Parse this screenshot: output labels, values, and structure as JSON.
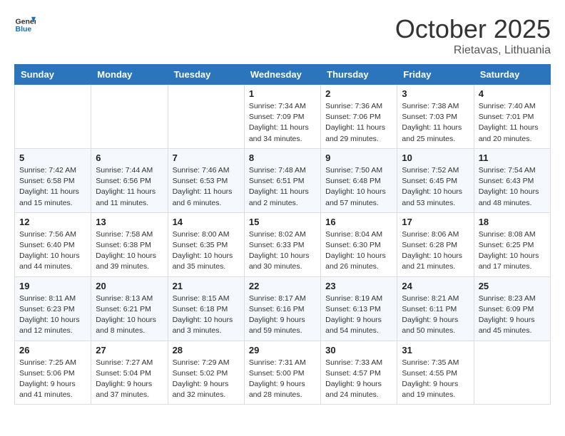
{
  "header": {
    "logo_general": "General",
    "logo_blue": "Blue",
    "month": "October 2025",
    "location": "Rietavas, Lithuania"
  },
  "days_of_week": [
    "Sunday",
    "Monday",
    "Tuesday",
    "Wednesday",
    "Thursday",
    "Friday",
    "Saturday"
  ],
  "weeks": [
    [
      {
        "day": "",
        "info": ""
      },
      {
        "day": "",
        "info": ""
      },
      {
        "day": "",
        "info": ""
      },
      {
        "day": "1",
        "info": "Sunrise: 7:34 AM\nSunset: 7:09 PM\nDaylight: 11 hours\nand 34 minutes."
      },
      {
        "day": "2",
        "info": "Sunrise: 7:36 AM\nSunset: 7:06 PM\nDaylight: 11 hours\nand 29 minutes."
      },
      {
        "day": "3",
        "info": "Sunrise: 7:38 AM\nSunset: 7:03 PM\nDaylight: 11 hours\nand 25 minutes."
      },
      {
        "day": "4",
        "info": "Sunrise: 7:40 AM\nSunset: 7:01 PM\nDaylight: 11 hours\nand 20 minutes."
      }
    ],
    [
      {
        "day": "5",
        "info": "Sunrise: 7:42 AM\nSunset: 6:58 PM\nDaylight: 11 hours\nand 15 minutes."
      },
      {
        "day": "6",
        "info": "Sunrise: 7:44 AM\nSunset: 6:56 PM\nDaylight: 11 hours\nand 11 minutes."
      },
      {
        "day": "7",
        "info": "Sunrise: 7:46 AM\nSunset: 6:53 PM\nDaylight: 11 hours\nand 6 minutes."
      },
      {
        "day": "8",
        "info": "Sunrise: 7:48 AM\nSunset: 6:51 PM\nDaylight: 11 hours\nand 2 minutes."
      },
      {
        "day": "9",
        "info": "Sunrise: 7:50 AM\nSunset: 6:48 PM\nDaylight: 10 hours\nand 57 minutes."
      },
      {
        "day": "10",
        "info": "Sunrise: 7:52 AM\nSunset: 6:45 PM\nDaylight: 10 hours\nand 53 minutes."
      },
      {
        "day": "11",
        "info": "Sunrise: 7:54 AM\nSunset: 6:43 PM\nDaylight: 10 hours\nand 48 minutes."
      }
    ],
    [
      {
        "day": "12",
        "info": "Sunrise: 7:56 AM\nSunset: 6:40 PM\nDaylight: 10 hours\nand 44 minutes."
      },
      {
        "day": "13",
        "info": "Sunrise: 7:58 AM\nSunset: 6:38 PM\nDaylight: 10 hours\nand 39 minutes."
      },
      {
        "day": "14",
        "info": "Sunrise: 8:00 AM\nSunset: 6:35 PM\nDaylight: 10 hours\nand 35 minutes."
      },
      {
        "day": "15",
        "info": "Sunrise: 8:02 AM\nSunset: 6:33 PM\nDaylight: 10 hours\nand 30 minutes."
      },
      {
        "day": "16",
        "info": "Sunrise: 8:04 AM\nSunset: 6:30 PM\nDaylight: 10 hours\nand 26 minutes."
      },
      {
        "day": "17",
        "info": "Sunrise: 8:06 AM\nSunset: 6:28 PM\nDaylight: 10 hours\nand 21 minutes."
      },
      {
        "day": "18",
        "info": "Sunrise: 8:08 AM\nSunset: 6:25 PM\nDaylight: 10 hours\nand 17 minutes."
      }
    ],
    [
      {
        "day": "19",
        "info": "Sunrise: 8:11 AM\nSunset: 6:23 PM\nDaylight: 10 hours\nand 12 minutes."
      },
      {
        "day": "20",
        "info": "Sunrise: 8:13 AM\nSunset: 6:21 PM\nDaylight: 10 hours\nand 8 minutes."
      },
      {
        "day": "21",
        "info": "Sunrise: 8:15 AM\nSunset: 6:18 PM\nDaylight: 10 hours\nand 3 minutes."
      },
      {
        "day": "22",
        "info": "Sunrise: 8:17 AM\nSunset: 6:16 PM\nDaylight: 9 hours\nand 59 minutes."
      },
      {
        "day": "23",
        "info": "Sunrise: 8:19 AM\nSunset: 6:13 PM\nDaylight: 9 hours\nand 54 minutes."
      },
      {
        "day": "24",
        "info": "Sunrise: 8:21 AM\nSunset: 6:11 PM\nDaylight: 9 hours\nand 50 minutes."
      },
      {
        "day": "25",
        "info": "Sunrise: 8:23 AM\nSunset: 6:09 PM\nDaylight: 9 hours\nand 45 minutes."
      }
    ],
    [
      {
        "day": "26",
        "info": "Sunrise: 7:25 AM\nSunset: 5:06 PM\nDaylight: 9 hours\nand 41 minutes."
      },
      {
        "day": "27",
        "info": "Sunrise: 7:27 AM\nSunset: 5:04 PM\nDaylight: 9 hours\nand 37 minutes."
      },
      {
        "day": "28",
        "info": "Sunrise: 7:29 AM\nSunset: 5:02 PM\nDaylight: 9 hours\nand 32 minutes."
      },
      {
        "day": "29",
        "info": "Sunrise: 7:31 AM\nSunset: 5:00 PM\nDaylight: 9 hours\nand 28 minutes."
      },
      {
        "day": "30",
        "info": "Sunrise: 7:33 AM\nSunset: 4:57 PM\nDaylight: 9 hours\nand 24 minutes."
      },
      {
        "day": "31",
        "info": "Sunrise: 7:35 AM\nSunset: 4:55 PM\nDaylight: 9 hours\nand 19 minutes."
      },
      {
        "day": "",
        "info": ""
      }
    ]
  ]
}
